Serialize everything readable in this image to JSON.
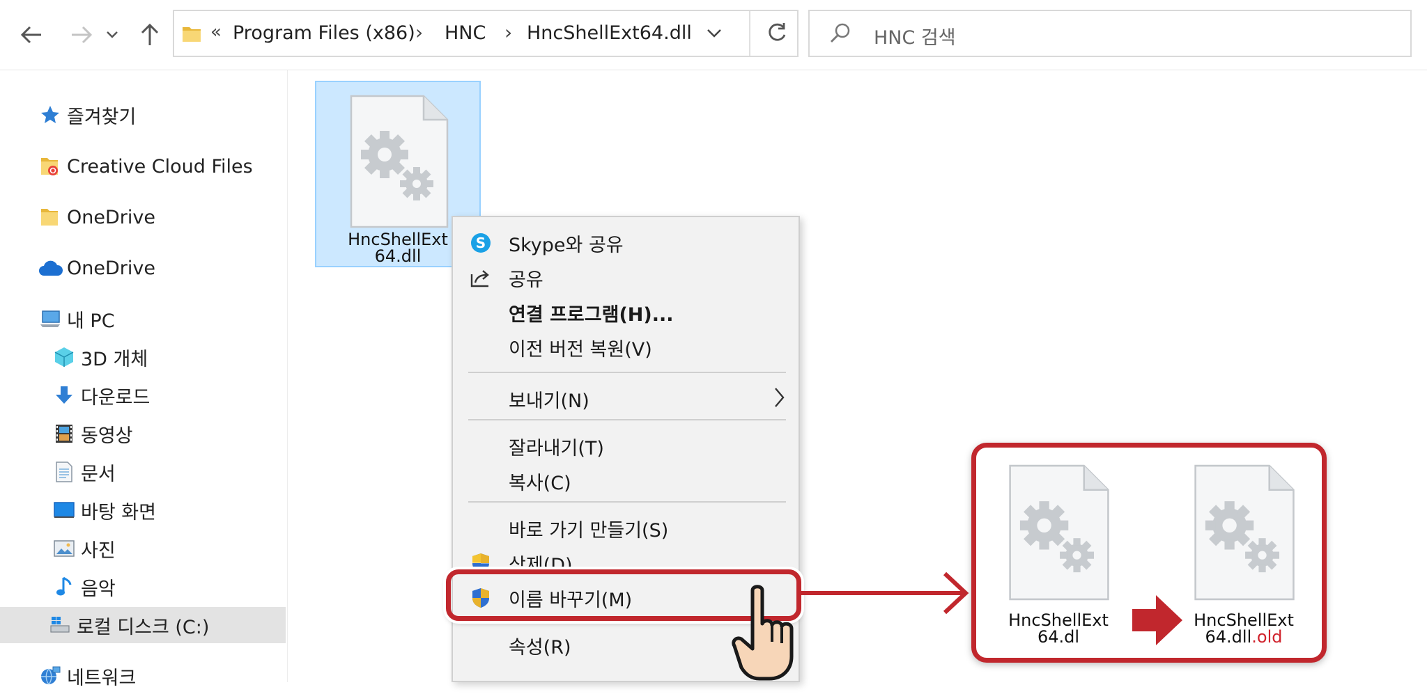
{
  "address_bar": {
    "overflow": "«",
    "crumbs": [
      "Program Files (x86)",
      "HNC",
      "HncShellExt64.dll"
    ]
  },
  "search": {
    "placeholder": "HNC 검색"
  },
  "sidebar": {
    "items": [
      {
        "label": "즐겨찾기",
        "icon": "star-icon"
      },
      {
        "label": "Creative Cloud Files",
        "icon": "creative-cloud-folder-icon"
      },
      {
        "label": "OneDrive",
        "icon": "folder-icon"
      },
      {
        "label": "OneDrive",
        "icon": "cloud-icon"
      },
      {
        "label": "내 PC",
        "icon": "pc-icon"
      },
      {
        "label": "3D 개체",
        "icon": "cube-icon"
      },
      {
        "label": "다운로드",
        "icon": "download-icon"
      },
      {
        "label": "동영상",
        "icon": "video-icon"
      },
      {
        "label": "문서",
        "icon": "document-icon"
      },
      {
        "label": "바탕 화면",
        "icon": "desktop-icon"
      },
      {
        "label": "사진",
        "icon": "picture-icon"
      },
      {
        "label": "음악",
        "icon": "music-icon"
      },
      {
        "label": "로컬 디스크 (C:)",
        "icon": "drive-icon"
      },
      {
        "label": "네트워크",
        "icon": "network-icon"
      }
    ]
  },
  "file": {
    "name_line1": "HncShellExt",
    "name_line2": "64.dll"
  },
  "context_menu": {
    "skype": "Skype와 공유",
    "share": "공유",
    "open_with": "연결 프로그램(H)...",
    "restore": "이전 버전 복원(V)",
    "send_to": "보내기(N)",
    "cut": "잘라내기(T)",
    "copy": "복사(C)",
    "shortcut": "바로 가기 만들기(S)",
    "delete": "삭제(D)",
    "rename": "이름 바꾸기(M)",
    "properties": "속성(R)"
  },
  "rename_result": {
    "before_line1": "HncShellExt",
    "before_line2": "64.dl",
    "after_line1": "HncShellExt",
    "after_line2_base": "64.dll",
    "after_line2_suffix": ".old"
  },
  "colors": {
    "highlight_red": "#c1272d",
    "selection_fill": "#cce8ff",
    "suffix_red": "#d0212b"
  }
}
